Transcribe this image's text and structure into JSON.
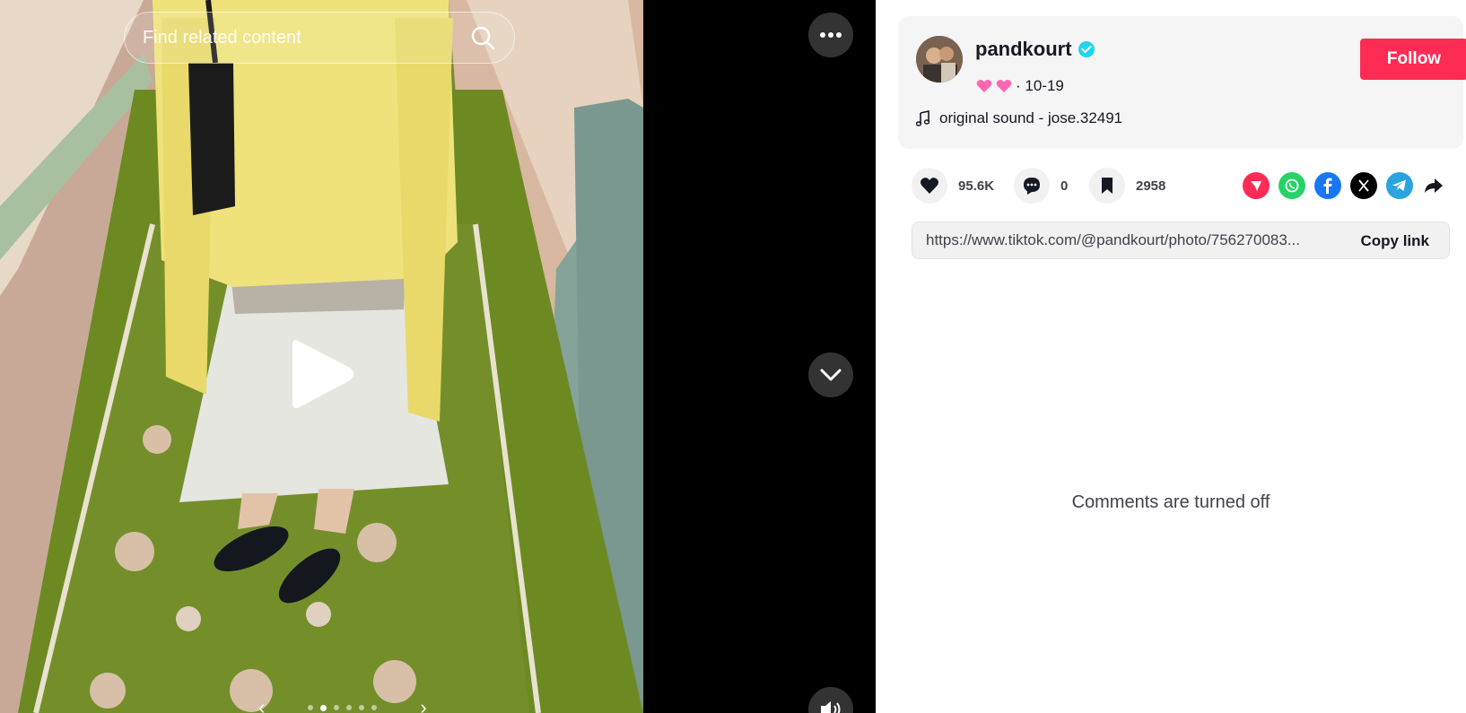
{
  "search": {
    "placeholder": "Find related content"
  },
  "author": {
    "username": "pandkourt",
    "date": "· 10-19",
    "follow_label": "Follow",
    "music": "original sound - jose.32491"
  },
  "stats": {
    "likes": "95.6K",
    "comments": "0",
    "saves": "2958"
  },
  "link": {
    "url": "https://www.tiktok.com/@pandkourt/photo/756270083...",
    "copy_label": "Copy link"
  },
  "comments": {
    "status": "Comments are turned off"
  },
  "carousel": {
    "total_dots": 6,
    "active_index": 1
  },
  "colors": {
    "follow": "#fe2c55",
    "verified": "#20d5ec",
    "whatsapp": "#25d366",
    "facebook": "#1877f2",
    "telegram": "#2aa3de",
    "tiktok_share": "#fe2c55"
  },
  "icons": [
    "search-icon",
    "play-icon",
    "more-icon",
    "chevron-down-icon",
    "volume-icon",
    "verified-icon",
    "music-note-icon",
    "heart-icon",
    "comment-icon",
    "bookmark-icon",
    "send-icon",
    "whatsapp-icon",
    "facebook-icon",
    "x-icon",
    "telegram-icon",
    "share-arrow-icon"
  ]
}
